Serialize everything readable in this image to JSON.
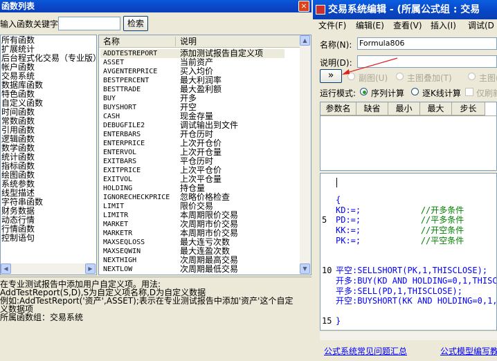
{
  "left_window": {
    "title": "函数列表",
    "close_glyph": "×",
    "search_label": "输入函数关键字",
    "search_value": "",
    "search_button": "检索",
    "categories": [
      "所有函数",
      "扩展统计",
      "后台程式化交易（专业版）",
      "帐户函数",
      "交易系统",
      "数据库函数",
      "特色函数",
      "自定义函数",
      "时间函数",
      "常数函数",
      "引用函数",
      "逻辑函数",
      "数学函数",
      "统计函数",
      "指标函数",
      "绘图函数",
      "系统参数",
      "线型描述",
      "字符串函数",
      "财务数据",
      "动态行情",
      "行情函数",
      "控制语句"
    ],
    "columns": {
      "name": "名称",
      "desc": "说明"
    },
    "functions": [
      {
        "name": "ADDTESTREPORT",
        "desc": "添加测试报告自定义项"
      },
      {
        "name": "ASSET",
        "desc": "当前资产"
      },
      {
        "name": "AVGENTERPRICE",
        "desc": "买入均价"
      },
      {
        "name": "BESTPERCENT",
        "desc": "最大利润率"
      },
      {
        "name": "BESTTRADE",
        "desc": "最大盈利额"
      },
      {
        "name": "BUY",
        "desc": "开多"
      },
      {
        "name": "BUYSHORT",
        "desc": "开空"
      },
      {
        "name": "CASH",
        "desc": "现金存量"
      },
      {
        "name": "DEBUGFILE2",
        "desc": "调试输出到文件"
      },
      {
        "name": "ENTERBARS",
        "desc": "开仓历时"
      },
      {
        "name": "ENTERPRICE",
        "desc": "上次开仓价"
      },
      {
        "name": "ENTERVOL",
        "desc": "上次开仓量"
      },
      {
        "name": "EXITBARS",
        "desc": "平仓历时"
      },
      {
        "name": "EXITPRICE",
        "desc": "上次平仓价"
      },
      {
        "name": "EXITVOL",
        "desc": "上次平仓量"
      },
      {
        "name": "HOLDING",
        "desc": "持仓量"
      },
      {
        "name": "IGNORECHECKPRICE",
        "desc": "忽略价格检查"
      },
      {
        "name": "LIMIT",
        "desc": "限价交易"
      },
      {
        "name": "LIMITR",
        "desc": "本周期限价交易"
      },
      {
        "name": "MARKET",
        "desc": "次周期市价交易"
      },
      {
        "name": "MARKETR",
        "desc": "本周期市价交易"
      },
      {
        "name": "MAXSEQLOSS",
        "desc": "最大连亏次数"
      },
      {
        "name": "MAXSEQWIN",
        "desc": "最大连盈次数"
      },
      {
        "name": "NEXTHIGH",
        "desc": "次周期最高交易"
      },
      {
        "name": "NEXTLOW",
        "desc": "次周期最低交易"
      }
    ],
    "description_lines": [
      "在专业测试报告中添加用户自定义项。用法:",
      "AddTestReport(S,D),S为自定义项名称,D为自定义数据",
      "例如:AddTestReport('资产',ASSET);表示在专业测试报告中添加'资产'这个自定",
      "义数据项",
      "所属函数组：交易系统"
    ]
  },
  "right_window": {
    "title": "交易系统编辑 - (所属公式组 : 交易",
    "menu": [
      "文件(F)",
      "编辑(E)",
      "查看(V)",
      "插入(I)",
      "调试(D"
    ],
    "name_label": "名称(N):",
    "name_value": "Formula806",
    "desc_label": "说明(D):",
    "desc_value": "",
    "expand_button": "»",
    "chart_options": [
      "副图(U)",
      "主图叠加(T)",
      "主图(W"
    ],
    "run_mode_label": "运行模式:",
    "run_modes": [
      "序列计算",
      "逐K线计算"
    ],
    "selected_run_mode": "序列计算",
    "only_refresh_label": "仅刷新",
    "param_columns": [
      "参数名",
      "缺省",
      "最小",
      "最大",
      "步长"
    ],
    "code_lines": [
      {
        "n": "",
        "t": ""
      },
      {
        "n": "",
        "t": ""
      },
      {
        "n": "",
        "t": "{"
      },
      {
        "n": "",
        "t": "KD:=;            //开多条件"
      },
      {
        "n": "5",
        "t": "PD:=;            //平多条件"
      },
      {
        "n": "",
        "t": "KK:=;            //开空条件"
      },
      {
        "n": "",
        "t": "PK:=;            //平空条件"
      },
      {
        "n": "",
        "t": ""
      },
      {
        "n": "",
        "t": ""
      },
      {
        "n": "10",
        "t": "平空:SELLSHORT(PK,1,THISCLOSE);"
      },
      {
        "n": "",
        "t": "开多:BUY(KD AND HOLDING=0,1,THISC"
      },
      {
        "n": "",
        "t": "平多:SELL(PD,1,THISCLOSE);"
      },
      {
        "n": "",
        "t": "开空:BUYSHORT(KK AND HOLDING=0,1,T"
      },
      {
        "n": "",
        "t": ""
      },
      {
        "n": "15",
        "t": "}"
      }
    ],
    "footer_links": [
      "公式系统常见问题汇总",
      "公式模型编写教"
    ],
    "colors": {
      "code_text": "#0000ff",
      "comment": "#008000",
      "annotation_arrow": "#e02020"
    }
  }
}
